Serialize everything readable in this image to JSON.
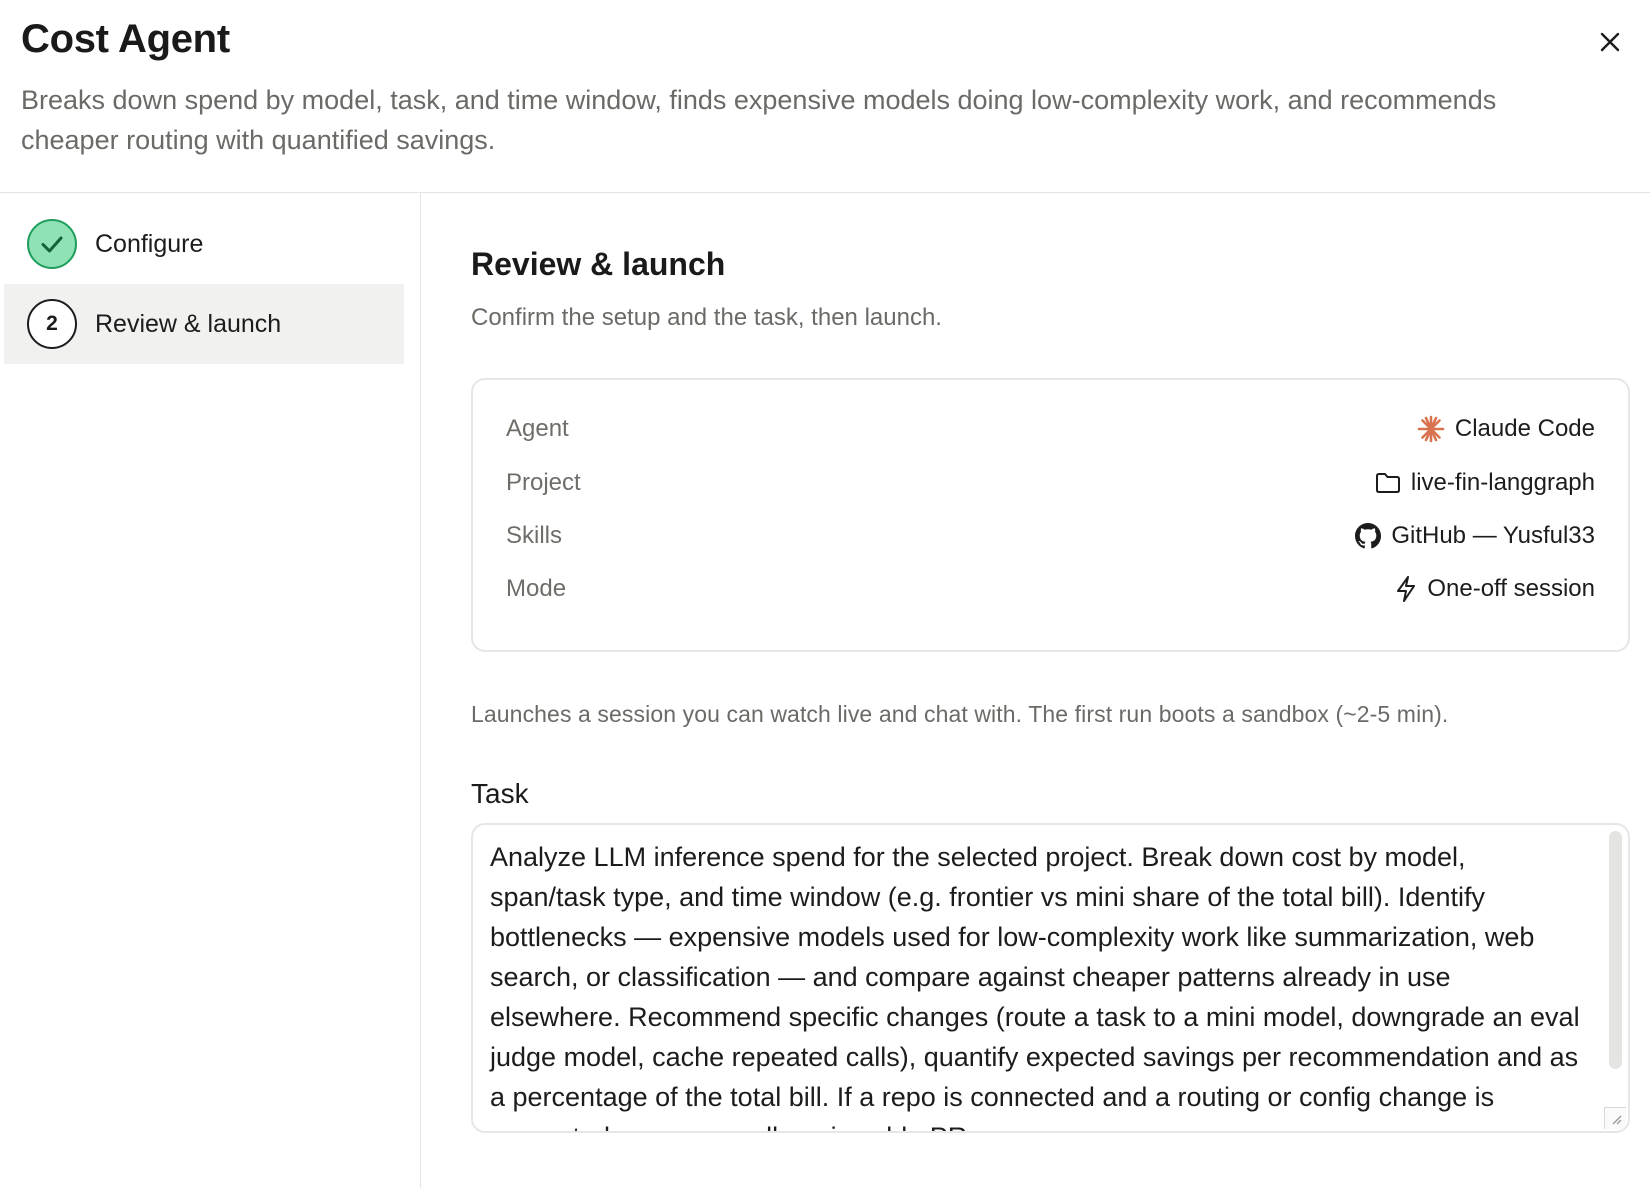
{
  "header": {
    "title": "Cost Agent",
    "subtitle": "Breaks down spend by model, task, and time window, finds expensive models doing low-complexity work, and recommends cheaper routing with quantified savings."
  },
  "steps": [
    {
      "number": "",
      "label": "Configure",
      "state": "done"
    },
    {
      "number": "2",
      "label": "Review & launch",
      "state": "active"
    }
  ],
  "review": {
    "title": "Review & launch",
    "subtitle": "Confirm the setup and the task, then launch.",
    "rows": [
      {
        "label": "Agent",
        "value": "Claude Code",
        "icon": "claude-sparkle-icon"
      },
      {
        "label": "Project",
        "value": "live-fin-langgraph",
        "icon": "folder-icon"
      },
      {
        "label": "Skills",
        "value": "GitHub — Yusful33",
        "icon": "github-icon"
      },
      {
        "label": "Mode",
        "value": "One-off session",
        "icon": "lightning-icon"
      }
    ],
    "info": "Launches a session you can watch live and chat with. The first run boots a sandbox (~2-5 min).",
    "task_label": "Task",
    "task_text": "Analyze LLM inference spend for the selected project. Break down cost by model, span/task type, and time window (e.g. frontier vs mini share of the total bill). Identify bottlenecks — expensive models used for low-complexity work like summarization, web search, or classification — and compare against cheaper patterns already in use elsewhere. Recommend specific changes (route a task to a mini model, downgrade an eval judge model, cache repeated calls), quantify expected savings per recommendation and as a percentage of the total bill. If a repo is connected and a routing or config change is warranted, open a small, reviewable PR."
  },
  "colors": {
    "accent_claude": "#d9734f",
    "check_fill": "#8ee2b5",
    "check_border": "#1f9d5b"
  }
}
